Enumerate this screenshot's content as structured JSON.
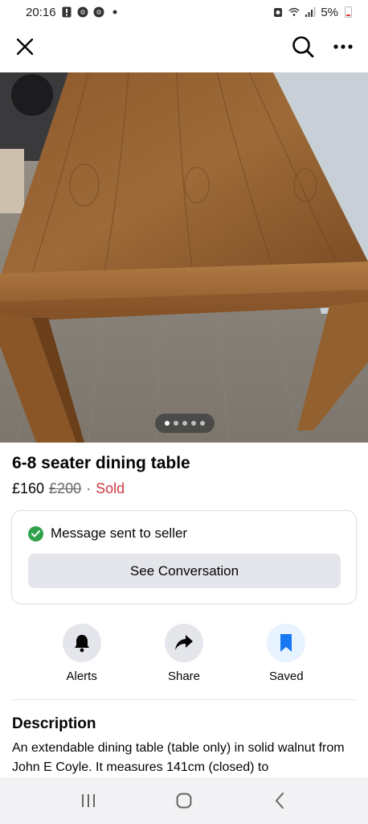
{
  "status_bar": {
    "time": "20:16",
    "battery": "5%",
    "icons": [
      "notification-icon",
      "chrome-icon",
      "chrome-icon",
      "dot-icon",
      "alarm-icon",
      "wifi-icon",
      "signal-icon",
      "battery-icon"
    ]
  },
  "top_nav": {
    "icons": [
      "close-icon",
      "search-icon",
      "more-icon"
    ]
  },
  "carousel": {
    "total": 5,
    "active": 1
  },
  "listing": {
    "title": "6-8 seater dining table",
    "price": "£160",
    "original_price": "£200",
    "separator": "·",
    "status": "Sold",
    "status_color": "#d13b45"
  },
  "message": {
    "text": "Message sent to seller",
    "button_label": "See Conversation",
    "check_color": "#31a24c"
  },
  "actions": [
    {
      "label": "Alerts",
      "icon": "bell-icon"
    },
    {
      "label": "Share",
      "icon": "share-icon"
    },
    {
      "label": "Saved",
      "icon": "bookmark-icon",
      "color": "#1877f2"
    }
  ],
  "description": {
    "title": "Description",
    "text": "An extendable dining table (table only) in solid walnut from John E Coyle. It measures 141cm (closed) to"
  },
  "bottom_nav": {
    "icons": [
      "recent-apps-icon",
      "home-icon",
      "back-icon"
    ]
  }
}
